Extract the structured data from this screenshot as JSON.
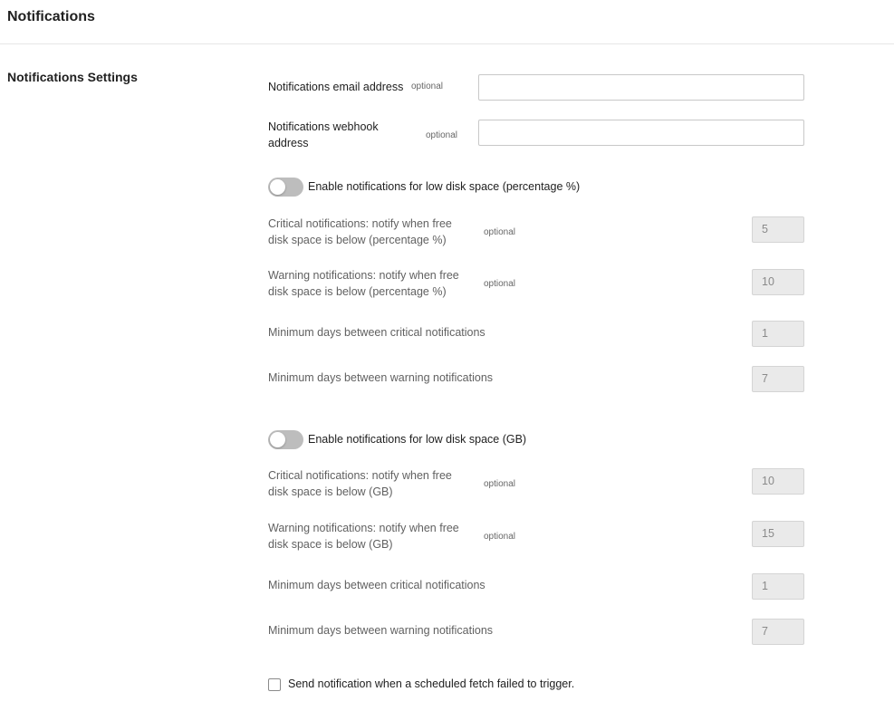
{
  "header": {
    "title": "Notifications"
  },
  "section": {
    "title": "Notifications Settings"
  },
  "email": {
    "label": "Notifications email address",
    "optional": "optional",
    "value": ""
  },
  "webhook": {
    "label_line1": "Notifications webhook",
    "label_line2": "address",
    "optional": "optional",
    "value": ""
  },
  "percent": {
    "toggle_label": "Enable notifications for low disk space (percentage %)",
    "enabled": false,
    "critical": {
      "line1": "Critical notifications: notify when free",
      "line2": "disk space is below (percentage %)",
      "optional": "optional",
      "value": "5"
    },
    "warning": {
      "line1": "Warning notifications: notify when free",
      "line2": "disk space is below (percentage %)",
      "optional": "optional",
      "value": "10"
    },
    "min_critical": {
      "label": "Minimum days between critical notifications",
      "value": "1"
    },
    "min_warning": {
      "label": "Minimum days between warning notifications",
      "value": "7"
    }
  },
  "gb": {
    "toggle_label": "Enable notifications for low disk space (GB)",
    "enabled": false,
    "critical": {
      "line1": "Critical notifications: notify when free",
      "line2": "disk space is below (GB)",
      "optional": "optional",
      "value": "10"
    },
    "warning": {
      "line1": "Warning notifications: notify when free",
      "line2": "disk space is below (GB)",
      "optional": "optional",
      "value": "15"
    },
    "min_critical": {
      "label": "Minimum days between critical notifications",
      "value": "1"
    },
    "min_warning": {
      "label": "Minimum days between warning notifications",
      "value": "7"
    }
  },
  "scheduled_fetch": {
    "label": "Send notification when a scheduled fetch failed to trigger.",
    "checked": false
  },
  "colors": {
    "toggle_off": "#bdbdbd",
    "disabled_input": "#eaeaea",
    "border": "#c8c8c8"
  }
}
